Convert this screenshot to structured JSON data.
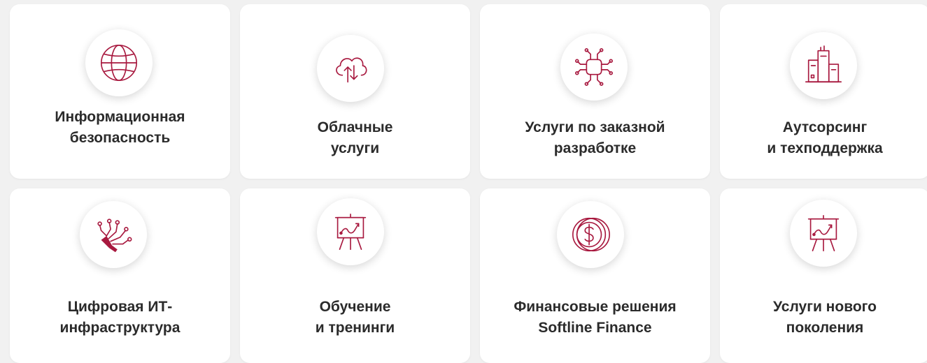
{
  "accent_color": "#a8193f",
  "cards": [
    {
      "label": "Информационная\nбезопасность",
      "icon": "globe-icon"
    },
    {
      "label": "Облачные\nуслуги",
      "icon": "cloud-sync-icon"
    },
    {
      "label": "Услуги по заказной\nразработке",
      "icon": "chip-circuit-icon"
    },
    {
      "label": "Аутсорсинг\nи техподдержка",
      "icon": "city-buildings-icon"
    },
    {
      "label": "Цифровая ИТ-\nинфраструктура",
      "icon": "circuit-branches-icon"
    },
    {
      "label": "Обучение\nи тренинги",
      "icon": "presentation-board-icon"
    },
    {
      "label": "Финансовые решения\nSoftline Finance",
      "icon": "coin-dollar-icon"
    },
    {
      "label": "Услуги нового\nпоколения",
      "icon": "presentation-board-icon"
    }
  ]
}
